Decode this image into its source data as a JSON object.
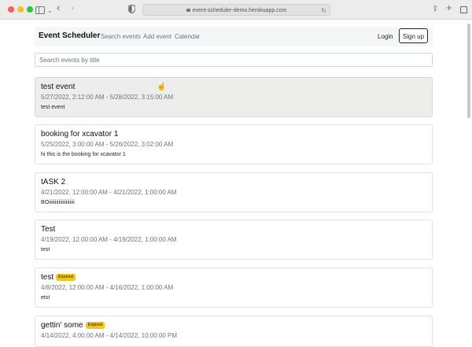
{
  "browser": {
    "url": "event-scheduler-demo.herokuapp.com"
  },
  "navbar": {
    "brand": "Event Scheduler",
    "links": [
      "Search events",
      "Add event",
      "Calendar"
    ],
    "login": "Login",
    "signup": "Sign up"
  },
  "search": {
    "placeholder": "Search events by title"
  },
  "events": [
    {
      "title": "test event",
      "date": "5/27/2022, 2:12:00 AM - 5/28/2022, 3:15:00 AM",
      "description": "test event",
      "badge": ""
    },
    {
      "title": "booking for xcavator 1",
      "date": "5/25/2022, 3:00:00 AM - 5/26/2022, 3:02:00 AM",
      "description": "hi this is the booking for xcavator 1",
      "badge": ""
    },
    {
      "title": "tASK 2",
      "date": "4/21/2022, 12:00:00 AM - 4/21/2022, 1:00:00 AM",
      "description": "BOiiiiiiiiiiiiiiiiiiiii",
      "badge": ""
    },
    {
      "title": "Test",
      "date": "4/19/2022, 12:00:00 AM - 4/19/2022, 1:00:00 AM",
      "description": "test",
      "badge": ""
    },
    {
      "title": "test",
      "date": "4/8/2022, 12:00:00 AM - 4/16/2022, 1:00:00 AM",
      "description": "etst",
      "badge": "Expired"
    },
    {
      "title": "gettin' some",
      "date": "4/14/2022, 4:00:00 AM - 4/14/2022, 10:00:00 PM",
      "description": "",
      "badge": "Expired"
    }
  ]
}
